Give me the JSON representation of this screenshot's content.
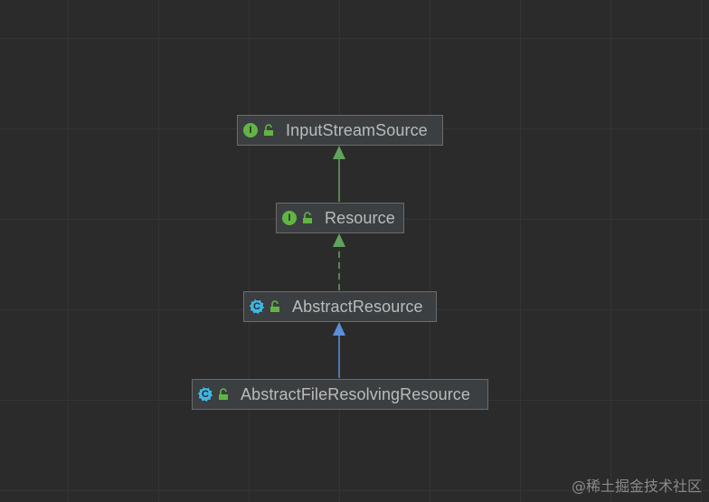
{
  "diagram": {
    "nodes": [
      {
        "id": "input-stream-source",
        "label": "InputStreamSource",
        "kind": "interface",
        "kind_glyph": "I",
        "modifier_icon": "unlock-icon"
      },
      {
        "id": "resource",
        "label": "Resource",
        "kind": "interface",
        "kind_glyph": "I",
        "modifier_icon": "unlock-icon"
      },
      {
        "id": "abstract-resource",
        "label": "AbstractResource",
        "kind": "abstract-class",
        "kind_glyph": "C",
        "modifier_icon": "unlock-icon"
      },
      {
        "id": "abstract-file-resolving-resource",
        "label": "AbstractFileResolvingResource",
        "kind": "abstract-class",
        "kind_glyph": "C",
        "modifier_icon": "unlock-icon"
      }
    ],
    "edges": [
      {
        "from": "resource",
        "to": "input-stream-source",
        "relation": "extends",
        "style": "solid",
        "color": "#5fa35c"
      },
      {
        "from": "abstract-resource",
        "to": "resource",
        "relation": "implements",
        "style": "dashed",
        "color": "#5fa35c"
      },
      {
        "from": "abstract-file-resolving-resource",
        "to": "abstract-resource",
        "relation": "extends",
        "style": "solid",
        "color": "#5b8fd9"
      }
    ]
  },
  "colors": {
    "background": "#2b2b2b",
    "grid": "#353535",
    "node_fill": "#3c3f41",
    "node_border": "#6b6b6b",
    "node_text": "#bbbbbb",
    "interface_icon": "#62b543",
    "class_icon": "#40b6e0",
    "implements_arrow": "#5fa35c",
    "extends_class_arrow": "#5b8fd9"
  },
  "watermark": "@稀土掘金技术社区"
}
